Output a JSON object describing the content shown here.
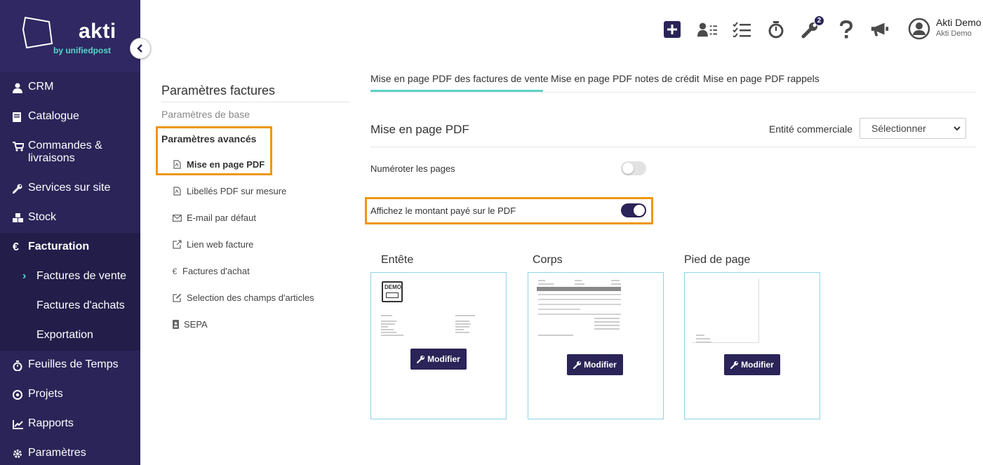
{
  "brand": {
    "name": "akti",
    "sub": "by unifiedpost"
  },
  "sidebar": {
    "items": [
      {
        "label": "CRM",
        "icon": "user-icon"
      },
      {
        "label": "Catalogue",
        "icon": "book-icon"
      },
      {
        "label": "Commandes &",
        "label2": "livraisons",
        "icon": "cart-icon"
      },
      {
        "label": "Services sur site",
        "icon": "wrench-icon"
      },
      {
        "label": "Stock",
        "icon": "cubes-icon"
      },
      {
        "label": "Facturation",
        "icon": "euro-icon"
      },
      {
        "label": "Feuilles de Temps",
        "icon": "stopwatch-icon"
      },
      {
        "label": "Projets",
        "icon": "target-icon"
      },
      {
        "label": "Rapports",
        "icon": "chart-icon"
      },
      {
        "label": "Paramètres",
        "icon": "gear-icon"
      }
    ],
    "sub_items": [
      "Factures de vente",
      "Factures d'achats",
      "Exportation"
    ]
  },
  "topbar": {
    "badge": "2",
    "user_name": "Akti Demo",
    "user_company": "Akti Demo"
  },
  "settings_menu": {
    "title": "Paramètres factures",
    "base": "Paramètres de base",
    "advanced": "Paramètres avancés",
    "items": [
      "Mise en page PDF",
      "Libellés PDF sur mesure",
      "E-mail par défaut",
      "Lien web facture",
      "Factures d'achat",
      "Selection des champs d'articles",
      "SEPA"
    ]
  },
  "tabs": [
    "Mise en page PDF des factures de vente",
    "Mise en page PDF notes de crédit",
    "Mise en page PDF rappels"
  ],
  "section": {
    "title": "Mise en page PDF",
    "entite_label": "Entité commerciale",
    "select_value": "Sélectionner",
    "toggle1_label": "Numéroter les pages",
    "toggle1_on": false,
    "toggle2_label": "Affichez le montant payé sur le PDF",
    "toggle2_on": true
  },
  "cards": [
    {
      "title": "Entête",
      "button": "Modifier",
      "stamp": "DEMO"
    },
    {
      "title": "Corps",
      "button": "Modifier"
    },
    {
      "title": "Pied de page",
      "button": "Modifier"
    }
  ],
  "colors": {
    "sidebar": "#2b2458",
    "accent": "#5fd3c7",
    "highlight": "#f0960e"
  }
}
